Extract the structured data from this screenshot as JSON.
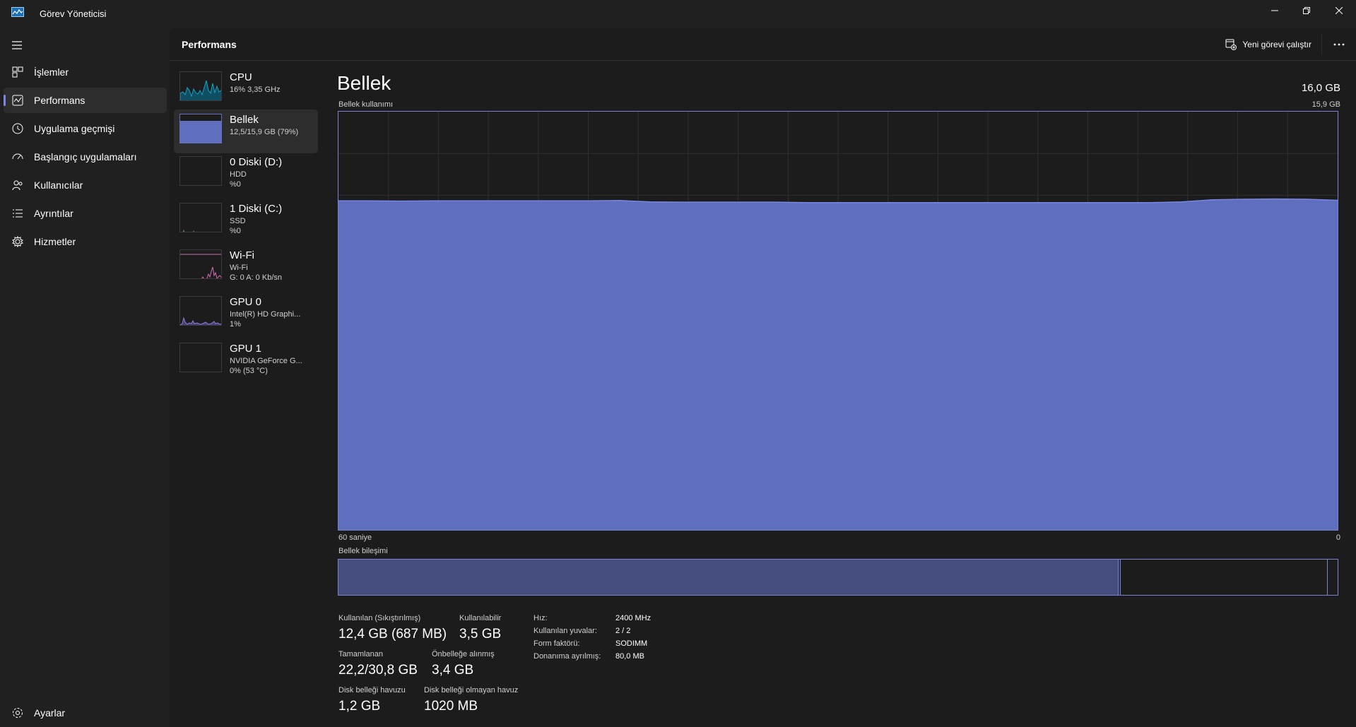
{
  "window": {
    "title": "Görev Yöneticisi",
    "minimize_icon": "minimize-icon",
    "restore_icon": "restore-icon",
    "close_icon": "close-icon"
  },
  "sidebar": {
    "items": [
      {
        "label": "İşlemler",
        "icon": "processes-icon"
      },
      {
        "label": "Performans",
        "icon": "performance-icon",
        "active": true
      },
      {
        "label": "Uygulama geçmişi",
        "icon": "history-icon"
      },
      {
        "label": "Başlangıç uygulamaları",
        "icon": "startup-icon"
      },
      {
        "label": "Kullanıcılar",
        "icon": "users-icon"
      },
      {
        "label": "Ayrıntılar",
        "icon": "details-icon"
      },
      {
        "label": "Hizmetler",
        "icon": "services-icon"
      }
    ],
    "settings_label": "Ayarlar"
  },
  "header": {
    "title": "Performans",
    "run_task_label": "Yeni görevi çalıştır"
  },
  "devices": [
    {
      "name": "CPU",
      "line1": "16% 3,35 GHz",
      "line2": ""
    },
    {
      "name": "Bellek",
      "line1": "12,5/15,9 GB (79%)",
      "line2": "",
      "active": true
    },
    {
      "name": "0 Diski (D:)",
      "line1": "HDD",
      "line2": "%0"
    },
    {
      "name": "1 Diski (C:)",
      "line1": "SSD",
      "line2": "%0"
    },
    {
      "name": "Wi-Fi",
      "line1": "Wi-Fi",
      "line2": "G: 0 A: 0 Kb/sn"
    },
    {
      "name": "GPU 0",
      "line1": "Intel(R) HD Graphi...",
      "line2": "1%"
    },
    {
      "name": "GPU 1",
      "line1": "NVIDIA GeForce G...",
      "line2": "0% (53 °C)"
    }
  ],
  "detail": {
    "title": "Bellek",
    "total": "16,0 GB",
    "usage_label": "Bellek kullanımı",
    "usage_max": "15,9 GB",
    "time_left": "60 saniye",
    "time_right": "0",
    "composition_label": "Bellek bileşimi",
    "composition": {
      "in_use_fraction": 0.78,
      "modified_fraction": 0.003,
      "standby_fraction": 0.207
    }
  },
  "stats": {
    "in_use_label": "Kullanılan (Sıkıştırılmış)",
    "in_use_value": "12,4 GB (687 MB)",
    "available_label": "Kullanılabilir",
    "available_value": "3,5 GB",
    "committed_label": "Tamamlanan",
    "committed_value": "22,2/30,8 GB",
    "cached_label": "Önbelleğe alınmış",
    "cached_value": "3,4 GB",
    "paged_label": "Disk belleği havuzu",
    "paged_value": "1,2 GB",
    "nonpaged_label": "Disk belleği olmayan havuz",
    "nonpaged_value": "1020 MB"
  },
  "specs": [
    {
      "key": "Hız:",
      "value": "2400 MHz"
    },
    {
      "key": "Kullanılan yuvalar:",
      "value": "2 / 2"
    },
    {
      "key": "Form faktörü:",
      "value": "SODIMM"
    },
    {
      "key": "Donanıma ayrılmış:",
      "value": "80,0 MB"
    }
  ],
  "chart_data": {
    "type": "area",
    "ylim": [
      0,
      15.9
    ],
    "xlim": [
      60,
      0
    ],
    "fill_color": "#5f6fbd",
    "line_color": "#7a86e6",
    "values": [
      12.51,
      12.51,
      12.5,
      12.51,
      12.51,
      12.51,
      12.51,
      12.51,
      12.51,
      12.52,
      12.47,
      12.46,
      12.46,
      12.46,
      12.46,
      12.44,
      12.44,
      12.44,
      12.44,
      12.44,
      12.44,
      12.44,
      12.44,
      12.44,
      12.44,
      12.44,
      12.44,
      12.47,
      12.55,
      12.57,
      12.58,
      12.57,
      12.53
    ]
  },
  "colors": {
    "accent": "#7b86e6",
    "memory_fill": "#5f6fbd",
    "composition_fill": "#454c7e",
    "cpu": "#17a1c3",
    "wifi": "#d36bb5",
    "gpu": "#8c7fd0"
  }
}
